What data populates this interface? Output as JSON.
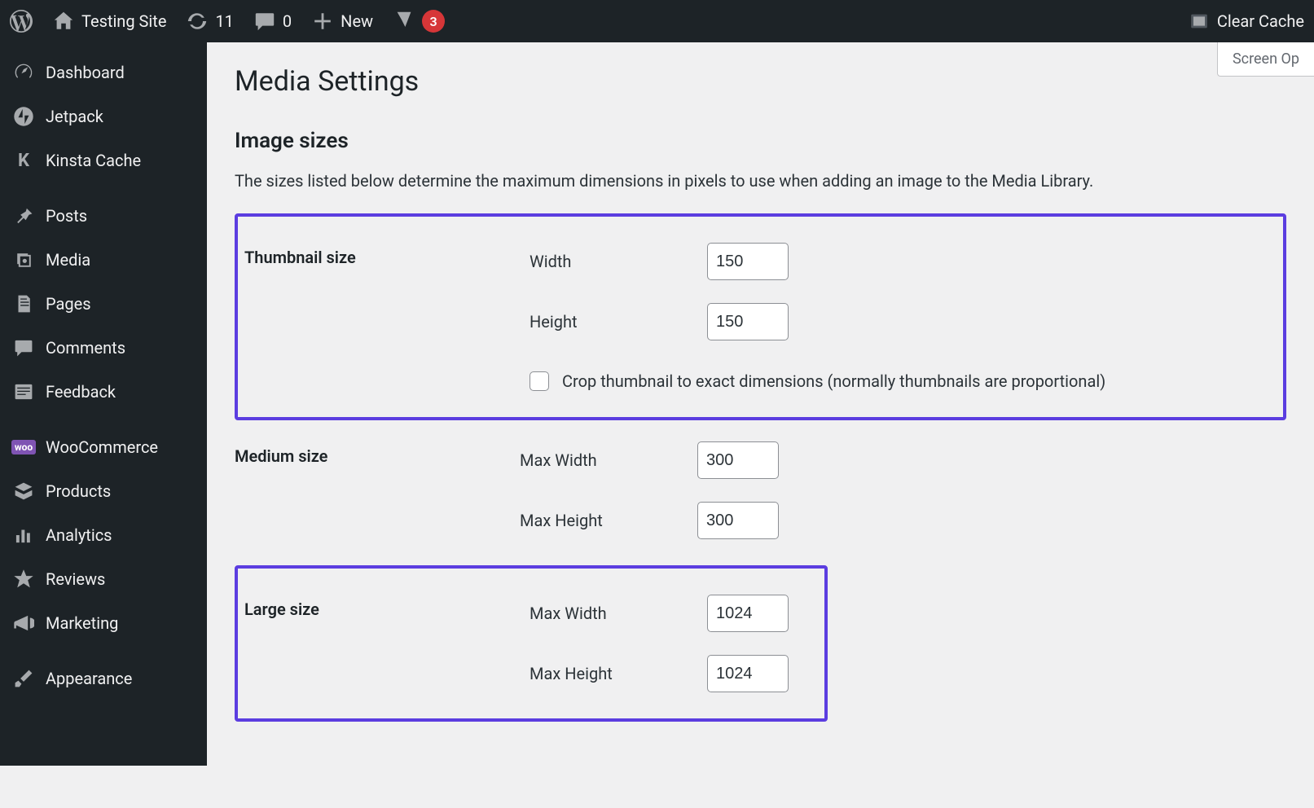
{
  "adminbar": {
    "site_name": "Testing Site",
    "updates_count": "11",
    "comments_count": "0",
    "new_label": "New",
    "yoast_badge": "3",
    "clear_cache": "Clear Cache"
  },
  "sidebar": {
    "items": [
      {
        "label": "Dashboard"
      },
      {
        "label": "Jetpack"
      },
      {
        "label": "Kinsta Cache"
      },
      {
        "label": "Posts"
      },
      {
        "label": "Media"
      },
      {
        "label": "Pages"
      },
      {
        "label": "Comments"
      },
      {
        "label": "Feedback"
      },
      {
        "label": "WooCommerce"
      },
      {
        "label": "Products"
      },
      {
        "label": "Analytics"
      },
      {
        "label": "Reviews"
      },
      {
        "label": "Marketing"
      },
      {
        "label": "Appearance"
      }
    ]
  },
  "screen_options_label": "Screen Op",
  "page": {
    "title": "Media Settings",
    "section_title": "Image sizes",
    "description": "The sizes listed below determine the maximum dimensions in pixels to use when adding an image to the Media Library.",
    "thumbnail": {
      "heading": "Thumbnail size",
      "width_label": "Width",
      "width_value": "150",
      "height_label": "Height",
      "height_value": "150",
      "crop_label": "Crop thumbnail to exact dimensions (normally thumbnails are proportional)"
    },
    "medium": {
      "heading": "Medium size",
      "max_width_label": "Max Width",
      "max_width_value": "300",
      "max_height_label": "Max Height",
      "max_height_value": "300"
    },
    "large": {
      "heading": "Large size",
      "max_width_label": "Max Width",
      "max_width_value": "1024",
      "max_height_label": "Max Height",
      "max_height_value": "1024"
    }
  }
}
